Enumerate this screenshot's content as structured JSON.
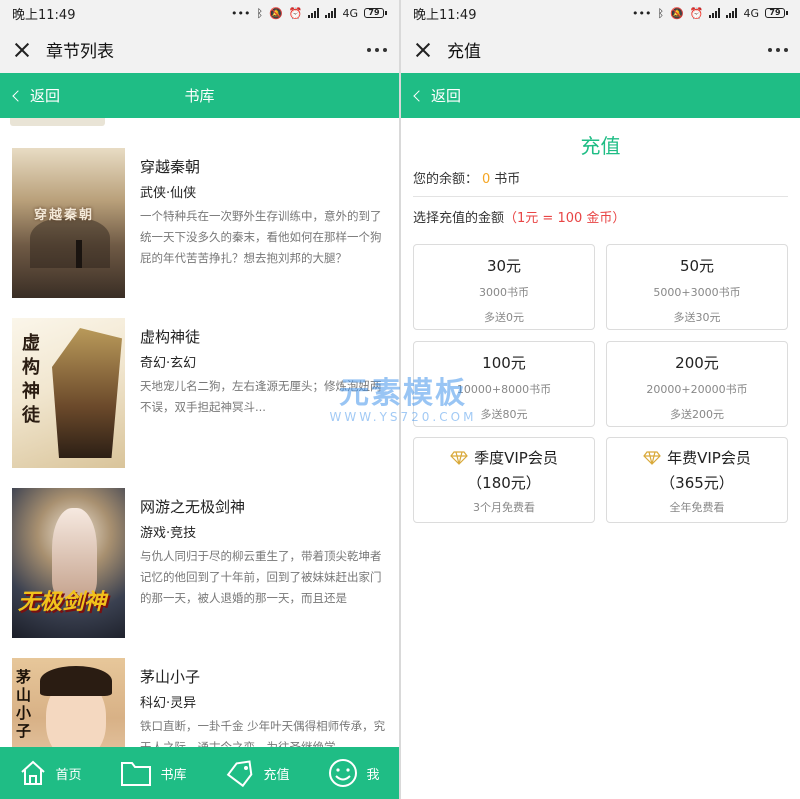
{
  "status_bar": {
    "time": "晚上11:49",
    "network": "4G",
    "battery": "79"
  },
  "left": {
    "window_title": "章节列表",
    "back_label": "返回",
    "header_title": "书库",
    "books": [
      {
        "title": "穿越秦朝",
        "category": "武侠·仙侠",
        "desc": "一个特种兵在一次野外生存训练中，意外的到了统一天下没多久的秦末，看他如何在那样一个狗屁的年代苦苦挣扎？想去抱刘邦的大腿？",
        "cover_text": "穿越秦朝"
      },
      {
        "title": "虚构神徒",
        "category": "奇幻·玄幻",
        "desc": "天地宠儿名二狗，左右逢源无厘头；修炼泡妞两不误，双手担起神冥斗...",
        "cover_text": "虚构神徒"
      },
      {
        "title": "网游之无极剑神",
        "category": "游戏·竞技",
        "desc": "与仇人同归于尽的柳云重生了，带着顶尖乾坤者记忆的他回到了十年前，回到了被妹妹赶出家门的那一天，被人退婚的那一天，而且还是",
        "cover_text": "无极剑神"
      },
      {
        "title": "茅山小子",
        "category": "科幻·灵异",
        "desc": "铁口直断，一卦千金 少年叶天偶得相师传承，究天人之际，通古今之变，为往圣继绝学...",
        "cover_text": "茅山小子"
      }
    ],
    "tabs": [
      {
        "label": "首页",
        "icon": "home-icon"
      },
      {
        "label": "书库",
        "icon": "folder-icon"
      },
      {
        "label": "充值",
        "icon": "tag-icon"
      },
      {
        "label": "我",
        "icon": "smile-icon"
      }
    ]
  },
  "right": {
    "window_title": "充值",
    "back_label": "返回",
    "page_title": "充值",
    "balance_label": "您的余额：",
    "balance_value": "0",
    "balance_unit": "书币",
    "choose_label": "选择充值的金额",
    "rate": "（1元 = 100 金币）",
    "options": [
      {
        "price": "30元",
        "coins": "3000书币",
        "bonus": "多送0元"
      },
      {
        "price": "50元",
        "coins": "5000+3000书币",
        "bonus": "多送30元"
      },
      {
        "price": "100元",
        "coins": "10000+8000书币",
        "bonus": "多送80元"
      },
      {
        "price": "200元",
        "coins": "20000+20000书币",
        "bonus": "多送200元"
      }
    ],
    "vip_options": [
      {
        "name": "季度VIP会员",
        "price": "（180元）",
        "note": "3个月免费看",
        "icon": "diamond-icon"
      },
      {
        "name": "年费VIP会员",
        "price": "（365元）",
        "note": "全年免费看",
        "icon": "diamond-icon"
      }
    ]
  },
  "watermark": {
    "line1": "元素模板",
    "line2": "WWW.YS720.COM"
  },
  "colors": {
    "accent": "#1fbd85",
    "balance": "#f5a623",
    "rate": "#e84545"
  }
}
